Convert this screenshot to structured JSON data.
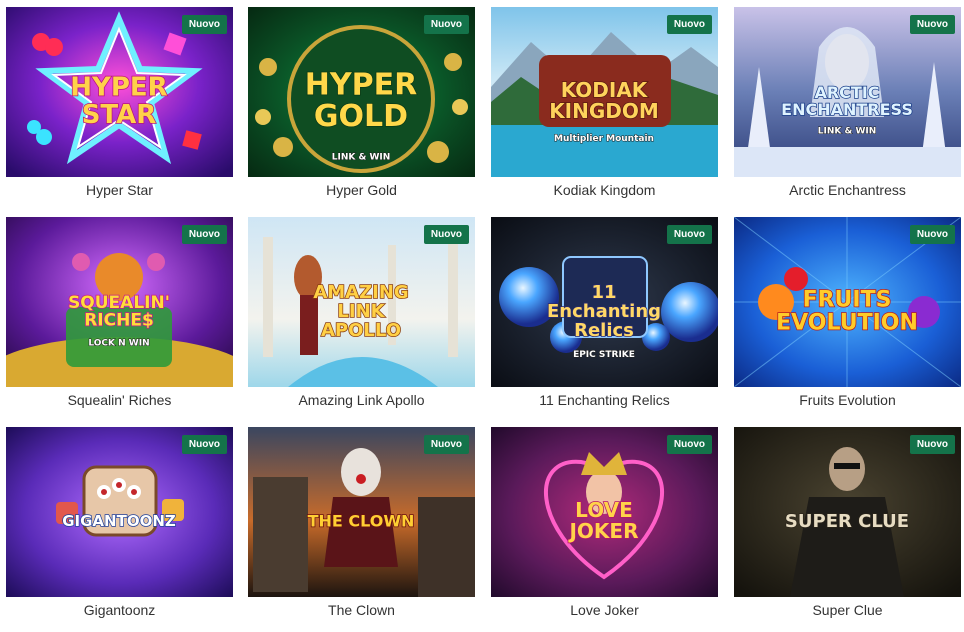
{
  "badge_label": "Nuovo",
  "games": [
    {
      "title": "Hyper Star",
      "logo_lines": [
        "HYPER",
        "STAR"
      ]
    },
    {
      "title": "Hyper Gold",
      "logo_lines": [
        "HYPER",
        "GOLD"
      ],
      "logo_sub": "LINK & WIN"
    },
    {
      "title": "Kodiak Kingdom",
      "logo_lines": [
        "KODIAK",
        "KINGDOM"
      ],
      "logo_sub": "Multiplier Mountain"
    },
    {
      "title": "Arctic Enchantress",
      "logo_lines": [
        "ARCTIC",
        "ENCHANTRESS"
      ],
      "logo_sub": "LINK & WIN"
    },
    {
      "title": "Squealin' Riches",
      "logo_lines": [
        "SQUEALIN'",
        "RICHE$"
      ],
      "logo_sub": "LOCK N WIN"
    },
    {
      "title": "Amazing Link Apollo",
      "logo_lines": [
        "AMAZING",
        "LINK",
        "APOLLO"
      ]
    },
    {
      "title": "11 Enchanting Relics",
      "logo_lines": [
        "11",
        "Enchanting",
        "Relics"
      ],
      "logo_sub": "EPIC STRIKE"
    },
    {
      "title": "Fruits Evolution",
      "logo_lines": [
        "FRUITS",
        "EVOLUTION"
      ]
    },
    {
      "title": "Gigantoonz",
      "logo_lines": [
        "GIGANTOONZ"
      ]
    },
    {
      "title": "The Clown",
      "logo_lines": [
        "THE CLOWN"
      ]
    },
    {
      "title": "Love Joker",
      "logo_lines": [
        "LOVE",
        "JOKER"
      ]
    },
    {
      "title": "Super Clue",
      "logo_lines": [
        "SUPER CLUE"
      ]
    }
  ],
  "colors": {
    "badge_bg": "#14734a",
    "badge_text": "#ffffff",
    "caption_text": "#333333"
  }
}
